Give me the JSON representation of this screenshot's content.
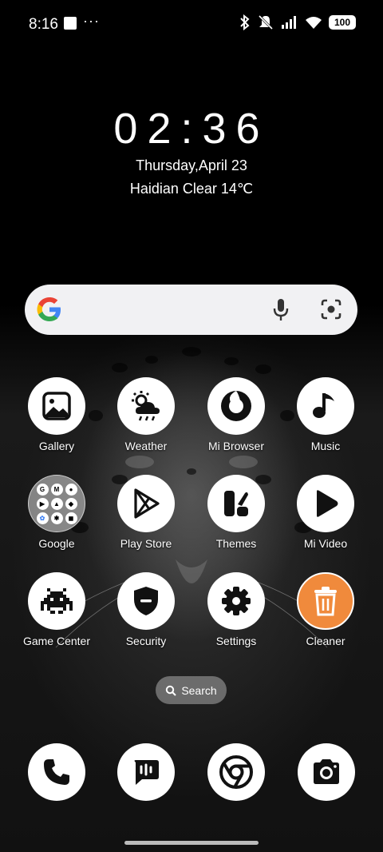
{
  "status_bar": {
    "time": "8:16",
    "dots": "···",
    "battery": "100"
  },
  "clock_widget": {
    "time": "02:36",
    "date": "Thursday,April 23",
    "weather": "Haidian Clear 14℃"
  },
  "search_bar": {
    "icons": [
      "google-logo",
      "mic-icon",
      "lens-icon"
    ]
  },
  "apps": [
    {
      "label": "Gallery",
      "icon": "gallery-icon"
    },
    {
      "label": "Weather",
      "icon": "weather-icon"
    },
    {
      "label": "Mi Browser",
      "icon": "browser-icon"
    },
    {
      "label": "Music",
      "icon": "music-icon"
    },
    {
      "label": "Google",
      "icon": "folder-icon"
    },
    {
      "label": "Play Store",
      "icon": "play-store-icon"
    },
    {
      "label": "Themes",
      "icon": "themes-icon"
    },
    {
      "label": "Mi Video",
      "icon": "video-icon"
    },
    {
      "label": "Game Center",
      "icon": "game-icon"
    },
    {
      "label": "Security",
      "icon": "security-icon"
    },
    {
      "label": "Settings",
      "icon": "settings-icon"
    },
    {
      "label": "Cleaner",
      "icon": "cleaner-icon"
    }
  ],
  "folder_apps": [
    "G",
    "M",
    "mic",
    "yt",
    "drive",
    "maps",
    "photos",
    "pin",
    "meet"
  ],
  "search_pill": {
    "label": "Search"
  },
  "dock": [
    "phone-icon",
    "messages-icon",
    "chrome-icon",
    "camera-icon"
  ],
  "colors": {
    "cleaner": "#f08a3c",
    "search_bar": "#f1f1f3"
  }
}
